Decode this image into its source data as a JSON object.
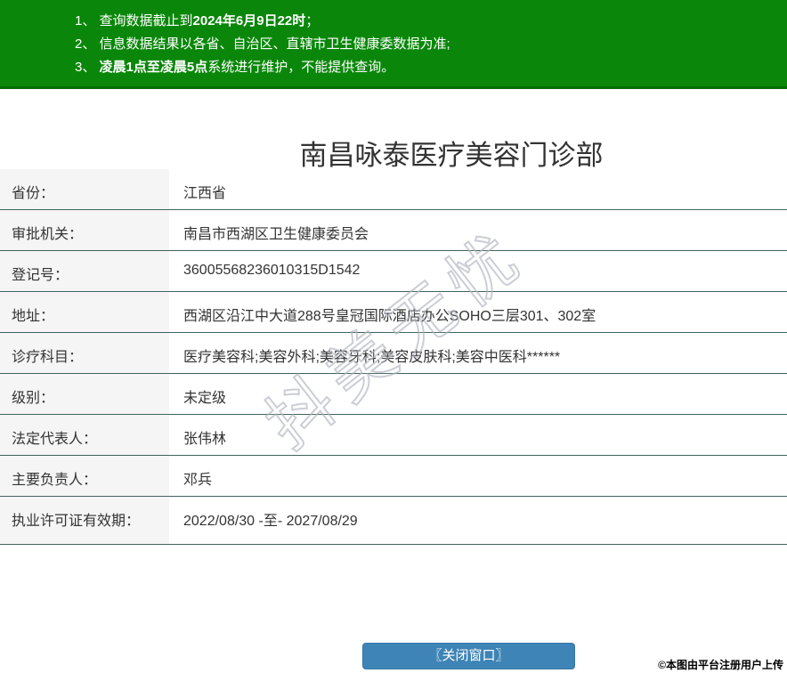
{
  "notice": {
    "items": [
      {
        "num": "1、",
        "pre": "查询数据截止到",
        "bold": "2024年6月9日22时",
        "post": "；"
      },
      {
        "num": "2、",
        "pre": "信息数据结果以各省、自治区、直辖市卫生健康委数据为准;",
        "bold": "",
        "post": ""
      },
      {
        "num": "3、",
        "pre": "",
        "bold": "凌晨1点至凌晨5点",
        "post": "系统进行维护，不能提供查询。"
      }
    ]
  },
  "title": "南昌咏泰医疗美容门诊部",
  "table": {
    "rows": [
      {
        "label": "省份：",
        "value": "江西省"
      },
      {
        "label": "审批机关：",
        "value": "南昌市西湖区卫生健康委员会"
      },
      {
        "label": "登记号：",
        "value": "36005568236010315D1542"
      },
      {
        "label": "地址：",
        "value": "西湖区沿江中大道288号皇冠国际酒店办公SOHO三层301、302室"
      },
      {
        "label": "诊疗科目：",
        "value": "医疗美容科;美容外科;美容牙科;美容皮肤科;美容中医科******"
      },
      {
        "label": "级别：",
        "value": "未定级"
      },
      {
        "label": "法定代表人：",
        "value": "张伟林"
      },
      {
        "label": "主要负责人：",
        "value": "邓兵"
      },
      {
        "label": "执业许可证有效期：",
        "value": "2022/08/30 -至- 2027/08/29"
      }
    ]
  },
  "watermark": "抖美无忧",
  "close_button_label": "〖关闭窗口〗",
  "footer_note": "©本图由平台注册用户上传",
  "colors": {
    "banner_green": "#0a870a",
    "banner_border": "#046c04",
    "row_border": "#41635d",
    "label_bg": "#f5f5f5",
    "button_blue": "#3e84b6",
    "text": "#333333"
  }
}
